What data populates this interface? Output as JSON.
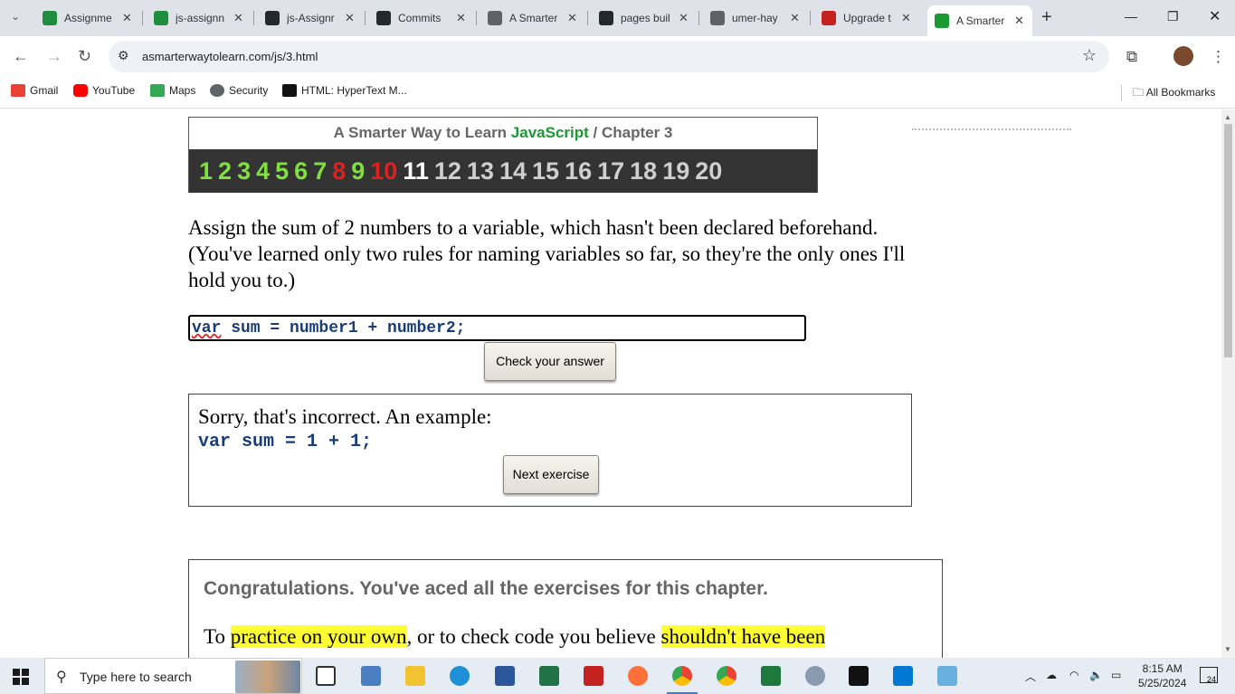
{
  "browser": {
    "tabs": [
      {
        "title": "Assignme",
        "icon": "classroom-icon",
        "color": "#1e8e3e"
      },
      {
        "title": "js-assignn",
        "icon": "classroom-icon",
        "color": "#1e8e3e"
      },
      {
        "title": "js-Assignr",
        "icon": "github-icon",
        "color": "#24292f"
      },
      {
        "title": "Commits",
        "icon": "github-icon",
        "color": "#24292f"
      },
      {
        "title": "A Smarter",
        "icon": "globe-icon",
        "color": "#5f6368"
      },
      {
        "title": "pages buil",
        "icon": "github-actions-icon",
        "color": "#24292f"
      },
      {
        "title": "umer-hay",
        "icon": "globe-icon",
        "color": "#5f6368"
      },
      {
        "title": "Upgrade t",
        "icon": "recorder-icon",
        "color": "#c5221f"
      },
      {
        "title": "A Smarter",
        "icon": "s-logo-icon",
        "color": "#1a9a32",
        "active": true
      }
    ],
    "url": "asmarterwaytolearn.com/js/3.html",
    "bookmarks": [
      "Gmail",
      "YouTube",
      "Maps",
      "Security",
      "HTML: HyperText M..."
    ],
    "all_bookmarks": "All Bookmarks"
  },
  "page": {
    "header": {
      "prefix": "A Smarter Way to Learn ",
      "brand": "JavaScript",
      "separator": " / ",
      "chapter": "Chapter 3"
    },
    "exercises": [
      {
        "n": "1",
        "state": "done"
      },
      {
        "n": "2",
        "state": "done"
      },
      {
        "n": "3",
        "state": "done"
      },
      {
        "n": "4",
        "state": "done"
      },
      {
        "n": "5",
        "state": "done"
      },
      {
        "n": "6",
        "state": "done"
      },
      {
        "n": "7",
        "state": "done"
      },
      {
        "n": "8",
        "state": "wrong"
      },
      {
        "n": "9",
        "state": "done"
      },
      {
        "n": "10",
        "state": "wrong"
      },
      {
        "n": "11",
        "state": "current"
      },
      {
        "n": "12",
        "state": "future"
      },
      {
        "n": "13",
        "state": "future"
      },
      {
        "n": "14",
        "state": "future"
      },
      {
        "n": "15",
        "state": "future"
      },
      {
        "n": "16",
        "state": "future"
      },
      {
        "n": "17",
        "state": "future"
      },
      {
        "n": "18",
        "state": "future"
      },
      {
        "n": "19",
        "state": "future"
      },
      {
        "n": "20",
        "state": "future"
      }
    ],
    "question": "Assign the sum of 2 numbers to a variable, which hasn't been declared beforehand. (You've learned only two rules for naming variables so far, so they're the only ones I'll hold you to.)",
    "answer": {
      "keyword": "var",
      "rest": " sum = number1 + number2;"
    },
    "check_button": "Check your answer",
    "result": {
      "message": "Sorry, that's incorrect. An example:",
      "example": "var sum = 1 + 1;",
      "next_button": "Next exercise"
    },
    "congrats": {
      "title": "Congratulations. You've aced all the exercises for this chapter.",
      "p1": "To ",
      "h1": "practice on your own",
      "p2": ", or to check code you believe ",
      "h2": "shouldn't have been"
    }
  },
  "taskbar": {
    "search_placeholder": "Type here to search",
    "time": "8:15 AM",
    "date": "5/25/2024",
    "notifications": "24"
  }
}
